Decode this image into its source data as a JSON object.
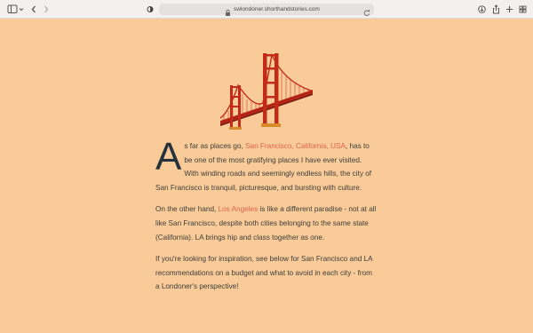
{
  "browser": {
    "url": "swlondoner.shorthandstories.com"
  },
  "icons": {
    "sidebar": "sidebar-toggle-icon",
    "back": "chevron-left-icon",
    "forward": "chevron-right-icon",
    "privacy": "shield-icon",
    "lock": "lock-icon",
    "reload": "reload-icon",
    "download": "download-icon",
    "share": "share-icon",
    "new_tab": "plus-icon",
    "tabs": "tab-overview-icon"
  },
  "colors": {
    "background": "#f8cb98",
    "link": "#e1624f",
    "bridge": "#c22b18"
  },
  "article": {
    "dropcap": "A",
    "p1_before": "s far as places go, ",
    "p1_link": "San Francisco, California, USA",
    "p1_after": ", has to be one of the most gratifying places I have ever visited. With winding roads and seemingly endless hills, the city of San Francisco is tranquil, picturesque, and bursting with culture.",
    "p2_before": "On the other hand, ",
    "p2_link": "Los Angeles",
    "p2_after": " is like a different paradise - not at all like San Francisco, despite both cities belonging to the same state (California). LA brings hip and class together as one.",
    "p3": "If you're looking for inspiration, see below for San Francisco and LA recommendations on a budget and what to avoid in each city - from a Londoner's perspective!"
  }
}
